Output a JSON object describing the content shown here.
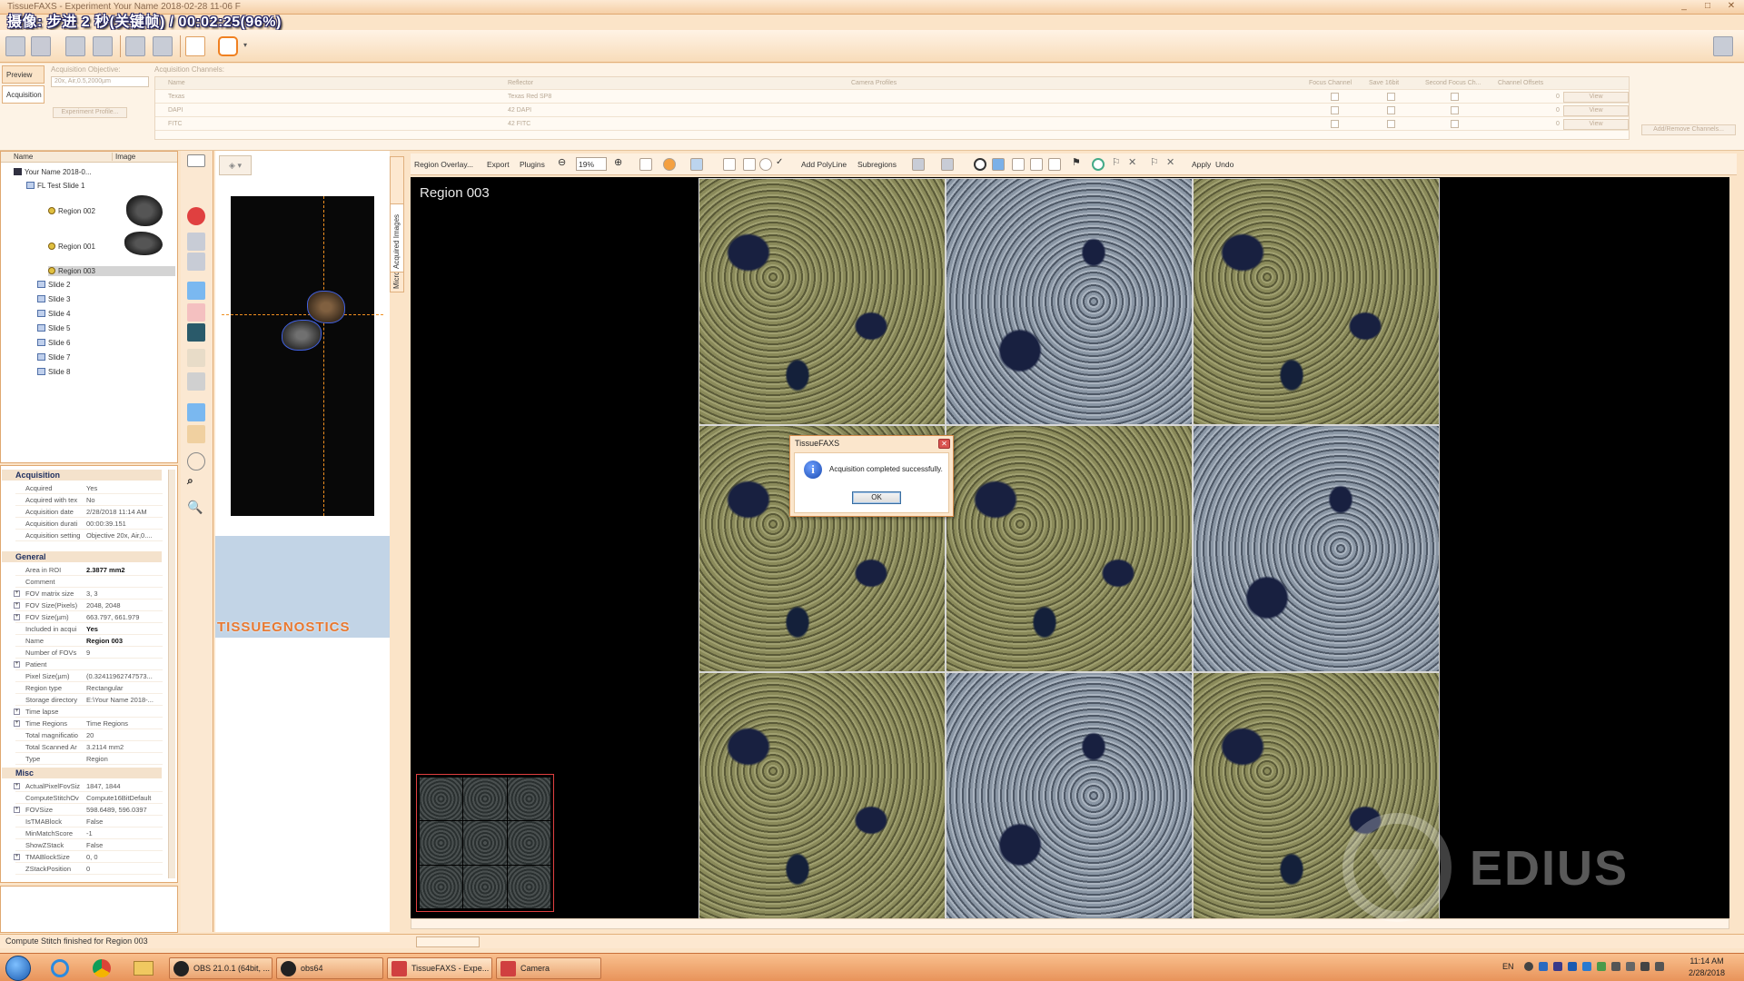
{
  "window": {
    "title": "TissueFAXS - Experiment Your Name 2018-02-28 11-06 F",
    "overlay_caption": "摄像: 步进 2 秒(关键帧) / 00:02:25(96%)",
    "minimize": "_",
    "maximize": "□",
    "close": "✕"
  },
  "side_tabs": {
    "preview": "Preview",
    "acquisition": "Acquisition"
  },
  "acquisition": {
    "objective_label": "Acquisition Objective:",
    "objective_value": "20x, Air,0.5,2000µm",
    "channels_label": "Acquisition Channels:",
    "experiment_profile_btn": "Experiment Profile...",
    "add_remove_btn": "Add/Remove Channels...",
    "columns": [
      "Name",
      "Reflector",
      "Camera Profiles",
      "Focus Channel",
      "Save 16bit",
      "Second Focus Ch...",
      "Channel Offsets"
    ],
    "channels": [
      {
        "name": "Texas",
        "reflector": "Texas Red SP8",
        "offset": "0",
        "view": "View"
      },
      {
        "name": "DAPI",
        "reflector": "42 DAPI",
        "offset": "0",
        "view": "View"
      },
      {
        "name": "FITC",
        "reflector": "42 FITC",
        "offset": "0",
        "view": "View"
      }
    ]
  },
  "tree": {
    "col_name": "Name",
    "col_image": "Image",
    "root": "Your Name 2018-0...",
    "slide1": "FL Test Slide 1",
    "regions": [
      "Region 002",
      "Region 001",
      "Region 003"
    ],
    "slides": [
      "Slide 2",
      "Slide 3",
      "Slide 4",
      "Slide 5",
      "Slide 6",
      "Slide 7",
      "Slide 8"
    ]
  },
  "properties": {
    "sections": {
      "acquisition": "Acquisition",
      "general": "General",
      "misc": "Misc"
    },
    "acquisition_rows": [
      {
        "k": "Acquired",
        "v": "Yes"
      },
      {
        "k": "Acquired with tex",
        "v": "No"
      },
      {
        "k": "Acquisition date",
        "v": "2/28/2018 11:14 AM"
      },
      {
        "k": "Acquisition durati",
        "v": "00:00:39.151"
      },
      {
        "k": "Acquisition setting",
        "v": "Objective 20x, Air,0...."
      }
    ],
    "general_rows": [
      {
        "k": "Area in ROI",
        "v": "2.3877 mm2"
      },
      {
        "k": "Comment",
        "v": ""
      },
      {
        "k": "FOV matrix size",
        "v": "3, 3"
      },
      {
        "k": "FOV Size(Pixels)",
        "v": "2048, 2048"
      },
      {
        "k": "FOV Size(µm)",
        "v": "663.797, 661.979"
      },
      {
        "k": "Included in acqui",
        "v": "Yes"
      },
      {
        "k": "Name",
        "v": "Region 003"
      },
      {
        "k": "Number of FOVs",
        "v": "9"
      },
      {
        "k": "Patient",
        "v": ""
      },
      {
        "k": "Pixel Size(µm)",
        "v": "(0.32411962747573..."
      },
      {
        "k": "Region type",
        "v": "Rectangular"
      },
      {
        "k": "Storage directory",
        "v": "E:\\Your Name 2018-..."
      },
      {
        "k": "Time lapse",
        "v": ""
      },
      {
        "k": "Time Regions",
        "v": "Time Regions"
      },
      {
        "k": "Total magnificatio",
        "v": "20"
      },
      {
        "k": "Total Scanned Ar",
        "v": "3.2114 mm2"
      },
      {
        "k": "Type",
        "v": "Region"
      }
    ],
    "misc_rows": [
      {
        "k": "ActualPixelFovSiz",
        "v": "1847, 1844"
      },
      {
        "k": "ComputeStitchOv",
        "v": "Compute16BitDefault"
      },
      {
        "k": "FOVSize",
        "v": "598.6489, 596.0397"
      },
      {
        "k": "IsTMABlock",
        "v": "False"
      },
      {
        "k": "MinMatchScore",
        "v": "-1"
      },
      {
        "k": "ShowZStack",
        "v": "False"
      },
      {
        "k": "TMABlockSize",
        "v": "0, 0"
      },
      {
        "k": "ZStackPosition",
        "v": "0"
      }
    ]
  },
  "overview": {
    "brand": "TISSUEGNOSTICS",
    "vtab_microscope": "Microscope",
    "vtab_acquired": "Acquired Images"
  },
  "viewer": {
    "region_overlay": "Region Overlay...",
    "export": "Export",
    "plugins": "Plugins",
    "zoom": "19%",
    "add_polyline": "Add PolyLine",
    "subregions": "Subregions",
    "apply": "Apply",
    "undo": "Undo",
    "region_label": "Region 003"
  },
  "dialog": {
    "title": "TissueFAXS",
    "message": "Acquisition completed successfully.",
    "ok": "OK",
    "icon": "info-icon"
  },
  "watermark": "EDIUS",
  "status": {
    "text": "Compute Stitch finished for Region 003"
  },
  "taskbar": {
    "tasks": [
      "OBS 21.0.1 (64bit, ...",
      "obs64",
      "TissueFAXS - Expe...",
      "Camera"
    ],
    "lang": "EN",
    "time": "11:14 AM",
    "date": "2/28/2018"
  },
  "colors": {
    "accent": "#f5cfa6",
    "dialog_close": "#d9534f",
    "minimap_border": "#e04040"
  }
}
